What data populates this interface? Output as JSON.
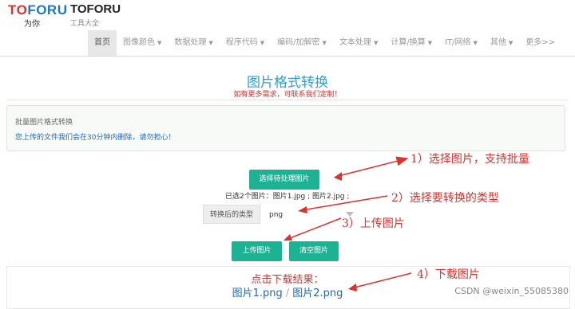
{
  "header": {
    "logo_part1": "TO",
    "logo_part2": "FO",
    "logo_part3": "RU",
    "logo_sub": "为你",
    "site_name": "TOFORU",
    "site_sub": "工具大全"
  },
  "nav": {
    "items": [
      {
        "label": "首页",
        "caret": ""
      },
      {
        "label": "图像颜色",
        "caret": "▼"
      },
      {
        "label": "数据处理",
        "caret": "▼"
      },
      {
        "label": "程序代码",
        "caret": "▼"
      },
      {
        "label": "编码/加解密",
        "caret": "▼"
      },
      {
        "label": "文本处理",
        "caret": "▼"
      },
      {
        "label": "计算/换算",
        "caret": "▼"
      },
      {
        "label": "IT/网络",
        "caret": "▼"
      },
      {
        "label": "其他",
        "caret": "▼"
      },
      {
        "label": "更多>>",
        "caret": ""
      }
    ]
  },
  "page": {
    "title": "图片格式转换",
    "notice": "如有更多需求，可联系我们定制！"
  },
  "info": {
    "title": "批量图片格式转换",
    "text": "您上传的文件我们会在30分钟内删除，请勿担心！"
  },
  "form": {
    "select_button": "选择待处理图片",
    "selected_files": "已选2个图片：图片1.jpg ; 图片2.jpg ;",
    "convert_label": "转换后的类型",
    "convert_value": "png",
    "upload_button": "上传图片",
    "clear_button": "清空图片"
  },
  "result": {
    "label": "点击下载结果：",
    "link1": "图片1.png",
    "separator": "/",
    "link2": "图片2.png"
  },
  "annotations": {
    "a1": "1）选择图片，支持批量",
    "a2": "2）选择要转换的类型",
    "a3": "3）上传图片",
    "a4": "4）下载图片"
  },
  "watermark": "CSDN @weixin_55085380",
  "colors": {
    "accent": "#1bb394",
    "title_blue": "#2ea0d8",
    "annotation_red": "#e0302a",
    "link_blue": "#1f66c0"
  }
}
